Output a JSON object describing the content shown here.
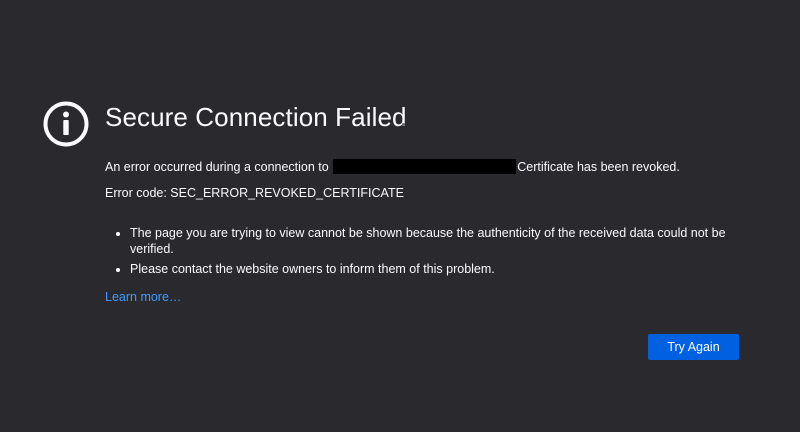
{
  "page": {
    "title": "Secure Connection Failed",
    "intro_prefix": "An error occurred during a connection to",
    "intro_suffix": "Certificate has been revoked.",
    "error_code": "Error code: SEC_ERROR_REVOKED_CERTIFICATE",
    "bullets": [
      "The page you are trying to view cannot be shown because the authenticity of the received data could not be verified.",
      "Please contact the website owners to inform them of this problem."
    ],
    "learn_more_label": "Learn more…",
    "try_again_label": "Try Again"
  },
  "icons": {
    "error": "info-circle-icon"
  },
  "colors": {
    "background": "#2a2a2e",
    "text": "#fbfbfe",
    "link": "#3e9bff",
    "button": "#0061e0",
    "redaction": "#000000"
  }
}
